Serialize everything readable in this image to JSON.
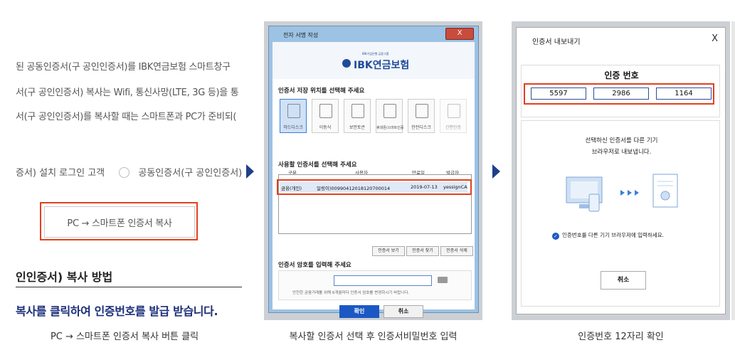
{
  "panel1": {
    "lines": [
      "된 공동인증서(구 공인인증서)를 IBK연금보험 스마트창구",
      "서(구 공인인증서) 복사는 Wifi, 통신사망(LTE, 3G 등)을 통",
      "서(구 공인인증서)를 복사할 때는 스마트폰과 PC가 준비되("
    ],
    "radio_label_1": "증서) 설치 로그인 고객",
    "radio_label_2": "공동인증서(구 공인인증서)",
    "pc_button": "PC → 스마트폰 인증서 복사",
    "heading": "인인증서) 복사 방법",
    "subheading": "복사를 클릭하여 인증번호를 발급 받습니다.",
    "caption": "PC → 스마트폰 인증서 복사 버튼 클릭"
  },
  "panel2": {
    "window_title": "전자 서명 작성",
    "close_label": "X",
    "logo_sub": "IBK기업은행 금융그룹",
    "logo": "IBK연금보험",
    "location_title": "인증서 저장 위치를 선택해 주세요",
    "locations": [
      "하드디스크",
      "이동식",
      "보안토큰",
      "휴대폰/스마트인증",
      "안전디스크",
      "간편인증"
    ],
    "cert_title": "사용할 인증서를 선택해 주세요",
    "columns": [
      "구분",
      "사용자",
      "만료일",
      "발급자"
    ],
    "cert_row": {
      "type": "금융(개인)",
      "user": "일링이)00990412018120700014",
      "expiry": "2019-07-13",
      "issuer": "yessignCA-"
    },
    "buttons": [
      "인증서 보기",
      "인증서 찾기",
      "인증서 삭제"
    ],
    "pw_title": "인증서 암호를 입력해 주세요",
    "pw_note": "안전한 금융거래를 위해 6개월마다 인증서 암호를 변경하시기 바랍니다.",
    "ok": "확인",
    "cancel": "취소",
    "caption": "복사할 인증서 선택 후 인증서비밀번호 입력"
  },
  "panel3": {
    "window_title": "인증서 내보내기",
    "close_label": "X",
    "code_title": "인증 번호",
    "codes": [
      "5597",
      "2986",
      "1164"
    ],
    "info_line1": "선택하신 인증서를 다른 기기",
    "info_line2": "브라우저로 내보냅니다.",
    "check_text": "인증번호를 다른 기기 브라우저에 입력하세요.",
    "cancel": "취소",
    "caption": "인증번호 12자리 확인"
  },
  "colors": {
    "highlight": "#e2401f",
    "brand": "#1e4a9a",
    "button": "#1c58c4"
  }
}
